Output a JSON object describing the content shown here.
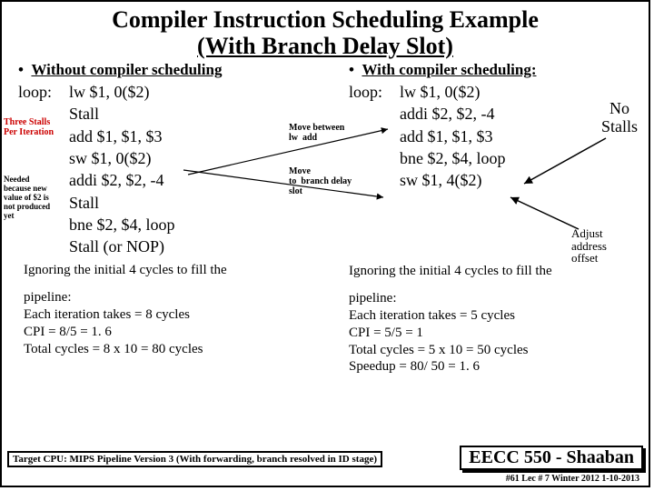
{
  "title_line1": "Compiler Instruction Scheduling Example",
  "title_line2": "(With Branch Delay Slot)",
  "left": {
    "heading_prefix": "Without compiler scheduling",
    "loop_label": "loop:",
    "instructions": [
      "lw $1, 0($2)",
      "Stall",
      "add $1, $1, $3",
      "sw $1, 0($2)",
      "addi $2, $2, -4",
      "Stall",
      "bne $2, $4, loop",
      "Stall (or NOP)"
    ],
    "note_three_stalls": "Three Stalls\nPer Iteration",
    "note_needed": "Needed\nbecause new\nvalue of $2 is\nnot produced yet",
    "ignoring": "Ignoring the initial 4 cycles to fill the",
    "pipeline": "pipeline:",
    "takes": "Each iteration takes = 8 cycles",
    "cpi": "CPI =  8/5 =  1. 6",
    "total": "Total cycles = 8 x 10 = 80 cycles"
  },
  "mid": {
    "move_between": "Move between\nlw  add",
    "move_branch": "Move\nto  branch delay\nslot"
  },
  "right": {
    "heading_prefix": "With compiler scheduling:",
    "loop_label": "loop:",
    "instructions": [
      "lw $1, 0($2)",
      "addi $2, $2, -4",
      "add $1, $1, $3",
      "bne $2, $4, loop",
      "sw $1, 4($2)"
    ],
    "no_stalls": "No\nStalls",
    "adjust": "Adjust\naddress\noffset",
    "ignoring": "Ignoring the initial 4 cycles to fill the",
    "pipeline": "pipeline:",
    "takes": "Each iteration takes = 5 cycles",
    "cpi": "CPI =  5/5 =  1",
    "total": "Total cycles = 5 x 10 = 50 cycles",
    "speedup": "Speedup =  80/ 50 =  1. 6"
  },
  "target": "Target CPU: MIPS Pipeline Version 3 (With forwarding, branch resolved in ID stage)",
  "eecc": "EECC 550 - Shaaban",
  "footer": "#61  Lec # 7  Winter 2012  1-10-2013"
}
